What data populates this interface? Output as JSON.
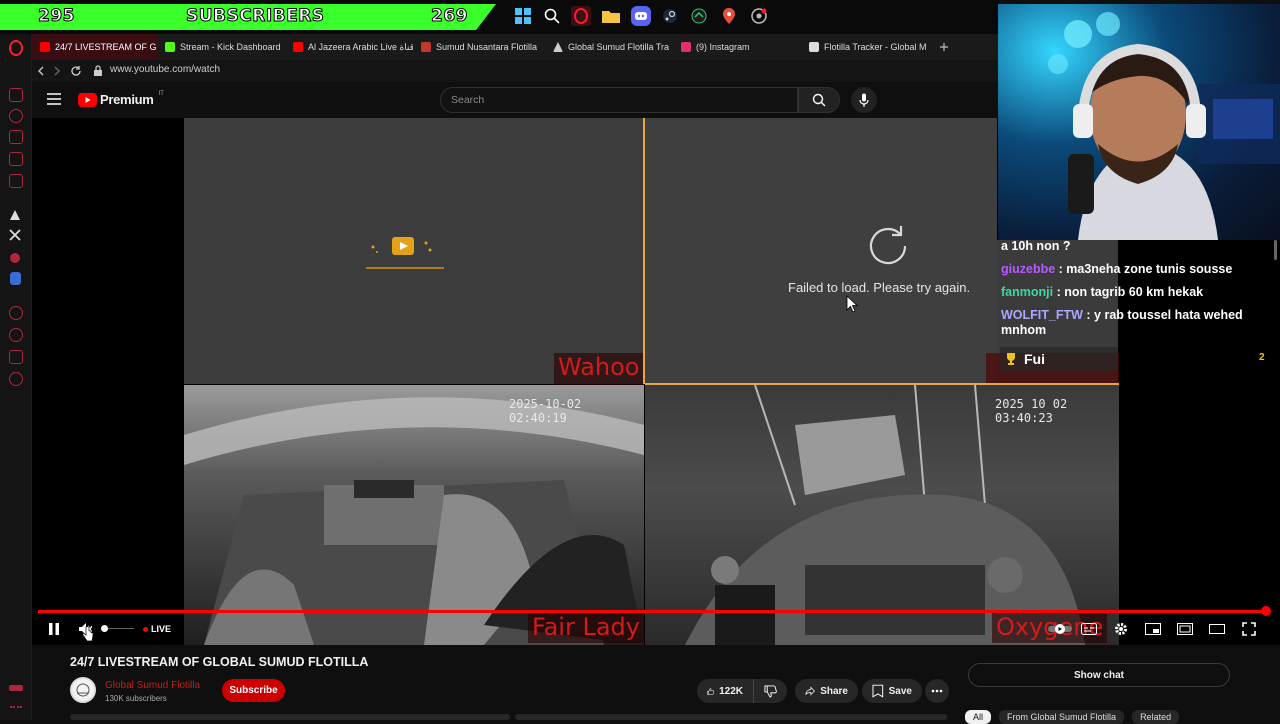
{
  "overlay": {
    "left_count": "295",
    "label": "SUBSCRIBERS",
    "right_count": "269"
  },
  "taskbar_icons": [
    "windows-icon",
    "search-icon",
    "opera-icon",
    "folder-icon",
    "discord-icon",
    "steam-icon",
    "app-icon",
    "maps-icon",
    "chrome-icon"
  ],
  "browser": {
    "tabs": [
      {
        "label": "24/7 LIVESTREAM OF GL",
        "color": "#ff0000"
      },
      {
        "label": "Stream - Kick Dashboard",
        "color": "#53fc18"
      },
      {
        "label": "Al Jazeera Arabic Live قناة",
        "color": "#ff0000"
      },
      {
        "label": "Sumud Nusantara Flotilla",
        "color": "#c0392b"
      },
      {
        "label": "Global Sumud Flotilla Tra",
        "color": "#cccccc"
      },
      {
        "label": "(9) Instagram",
        "color": "#e1306c"
      },
      {
        "label": "Flotilla Tracker - Global M",
        "color": "#dddddd"
      }
    ],
    "url": "www.youtube.com/watch"
  },
  "youtube": {
    "logo_text": "Premium",
    "region": "IT",
    "search_placeholder": "Search"
  },
  "video": {
    "failed_message": "Failed to load. Please try again.",
    "cam_labels": [
      "Wahoo",
      "Fair Lady",
      "Oxygene"
    ],
    "timestamps": [
      "2025-10-02 02:40:19",
      "2025 10 02 03:40:23"
    ],
    "live_label": "LIVE",
    "progress": 1.0
  },
  "chat": {
    "messages": [
      {
        "user": "",
        "text": "a 10h non ?",
        "color": "#ffffff"
      },
      {
        "user": "giuzebbe",
        "text": " : ma3neha zone tunis sousse",
        "color": "#b65cff"
      },
      {
        "user": "fanmonji",
        "text": " : non tagrib 60 km hekak",
        "color": "#3fd6a8"
      },
      {
        "user": "WOLFIT_FTW",
        "text": " : y rab toussel hata wehed mnhom",
        "color": "#a8a8ff"
      }
    ],
    "badge_text": "Fui",
    "badge_count": "2"
  },
  "details": {
    "title": "24/7 LIVESTREAM OF GLOBAL SUMUD FLOTILLA",
    "channel": "Global Sumud Flotilla",
    "subscribers": "130K subscribers",
    "subscribe_label": "Subscribe",
    "likes": "122K",
    "share_label": "Share",
    "save_label": "Save",
    "show_chat_label": "Show chat",
    "chips": [
      "All",
      "From Global Sumud Flotilla",
      "Related"
    ]
  },
  "colors": {
    "accent": "#ff0000",
    "overlay_green": "#3bff2a",
    "opera_red": "#b0263a"
  }
}
